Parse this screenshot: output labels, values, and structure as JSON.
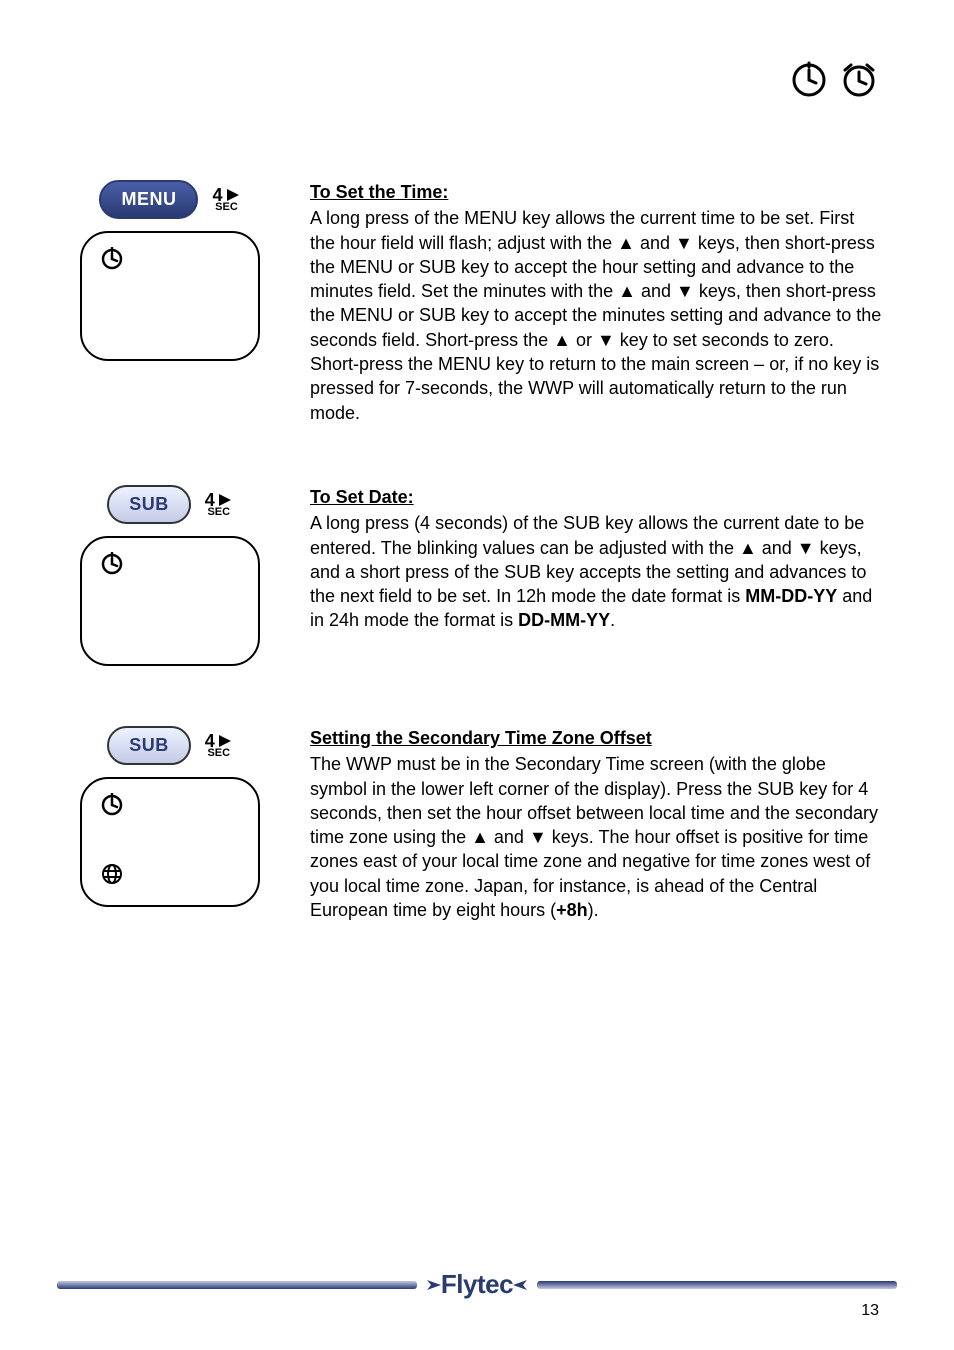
{
  "header_icons": [
    "clock-icon",
    "alarm-clock-icon"
  ],
  "sec_badge": {
    "num": "4",
    "unit": "SEC"
  },
  "buttons": {
    "menu": "MENU",
    "sub": "SUB"
  },
  "sections": {
    "set_time": {
      "title": "To Set the Time:",
      "body": "A long press of the MENU key allows the current time to be set. First the hour field will flash; adjust with the ▲ and ▼ keys, then short-press the MENU or SUB key to accept the hour setting and advance to the minutes field. Set the minutes with the ▲ and ▼ keys, then short-press the MENU or SUB key to accept the minutes setting and advance to the seconds field. Short-press the ▲ or ▼ key to set seconds to zero. Short-press the MENU key to return to the main screen – or, if no key is pressed for 7-seconds, the WWP will automatically return to the run mode."
    },
    "set_date": {
      "title": "To Set Date:",
      "body_pre": "A long press (4 seconds) of the SUB key allows the current date to be entered. The blinking values can be adjusted with the ▲ and ▼ keys, and a short press of the SUB key accepts the setting and advances to the next field to be set. In 12h mode the date format is ",
      "fmt12": "MM-DD-YY",
      "body_mid": " and in 24h mode the format is ",
      "fmt24": "DD-MM-YY",
      "body_post": "."
    },
    "set_offset": {
      "title": "Setting the Secondary Time Zone Offset",
      "body_pre": "The WWP must be in the Secondary Time screen (with the globe symbol in the lower left corner of the display). Press the SUB key for 4 seconds, then set the hour offset between local time and the secondary time zone using the ▲ and ▼ keys. The hour offset is positive for time zones east of your local time zone and negative for time zones west of you local time zone. Japan, for instance, is ahead of the Central European time by eight hours (",
      "offset": "+8h",
      "body_post": ")."
    }
  },
  "footer": {
    "brand": "Flytec",
    "page": "13"
  }
}
